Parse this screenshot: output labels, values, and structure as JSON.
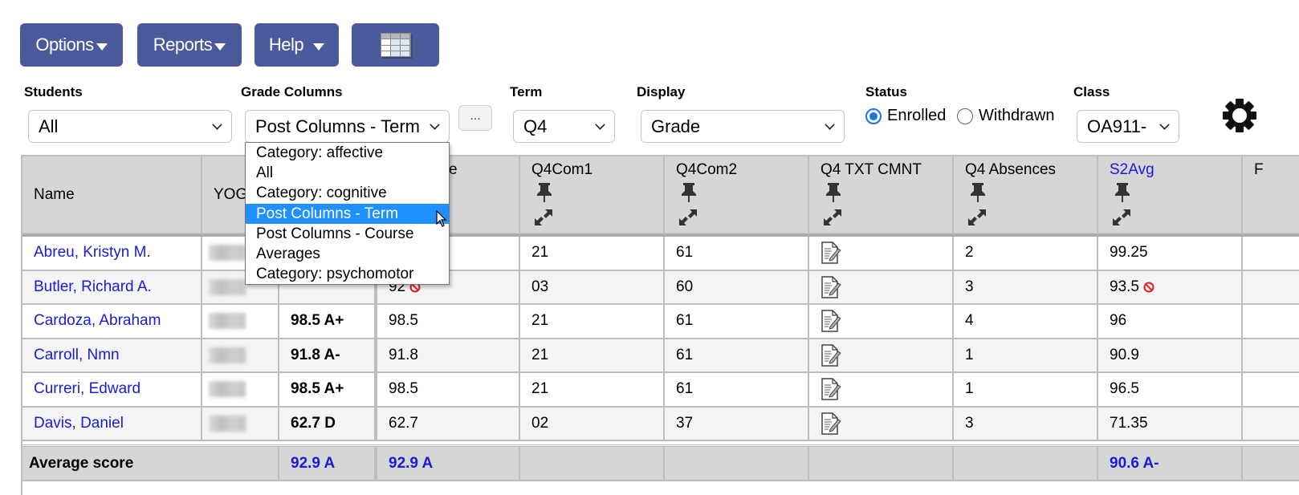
{
  "toolbar": {
    "options_label": "Options",
    "reports_label": "Reports",
    "help_label": "Help",
    "grid_view_icon": "spreadsheet-grid-icon"
  },
  "filters": {
    "students": {
      "label": "Students",
      "value": "All"
    },
    "grade_columns": {
      "label": "Grade Columns",
      "value": "Post Columns - Term",
      "more_label": "...",
      "options": [
        "Category: affective",
        "All",
        "Category: cognitive",
        "Post Columns - Term",
        "Post Columns - Course",
        "Averages",
        "Category: psychomotor"
      ],
      "highlighted_index": 3
    },
    "term": {
      "label": "Term",
      "value": "Q4"
    },
    "display": {
      "label": "Display",
      "value": "Grade"
    },
    "status": {
      "label": "Status",
      "options": [
        "Enrolled",
        "Withdrawn"
      ],
      "selected": "Enrolled"
    },
    "class": {
      "label": "Class",
      "value": "OA911-"
    },
    "settings_icon": "gear-icon"
  },
  "table": {
    "headers": {
      "name": "Name",
      "yog": "YOG",
      "term_grade": "",
      "term_partial": "e",
      "q4com1": "Q4Com1",
      "q4com2": "Q4Com2",
      "q4txt": "Q4 TXT CMNT",
      "q4abs": "Q4 Absences",
      "s2avg": "S2Avg",
      "next": "F"
    },
    "rows": [
      {
        "name": "Abreu, Kristyn M.",
        "grade": "",
        "term": "",
        "com1": "21",
        "com2": "61",
        "abs": "2",
        "s2avg": "99.25",
        "term_flag": false,
        "s2_flag": false
      },
      {
        "name": "Butler, Richard A.",
        "grade": "",
        "term": "92",
        "com1": "03",
        "com2": "60",
        "abs": "3",
        "s2avg": "93.5",
        "term_flag": true,
        "s2_flag": true
      },
      {
        "name": "Cardoza, Abraham",
        "grade": "98.5 A+",
        "term": "98.5",
        "com1": "21",
        "com2": "61",
        "abs": "4",
        "s2avg": "96",
        "term_flag": false,
        "s2_flag": false
      },
      {
        "name": "Carroll, Nmn",
        "grade": "91.8 A-",
        "term": "91.8",
        "com1": "21",
        "com2": "61",
        "abs": "1",
        "s2avg": "90.9",
        "term_flag": false,
        "s2_flag": false
      },
      {
        "name": "Curreri, Edward",
        "grade": "98.5 A+",
        "term": "98.5",
        "com1": "21",
        "com2": "61",
        "abs": "1",
        "s2avg": "96.5",
        "term_flag": false,
        "s2_flag": false
      },
      {
        "name": "Davis, Daniel",
        "grade": "62.7 D",
        "term": "62.7",
        "com1": "02",
        "com2": "37",
        "abs": "3",
        "s2avg": "71.35",
        "term_flag": false,
        "s2_flag": false
      }
    ],
    "footer": {
      "label": "Average score",
      "grade": "92.9 A",
      "term": "92.9 A",
      "s2avg": "90.6 A-"
    }
  },
  "colors": {
    "button_bg": "#4a5a9b",
    "link": "#1a1ad8",
    "highlight": "#1e90ff",
    "header_bg": "#d6d6d6"
  }
}
